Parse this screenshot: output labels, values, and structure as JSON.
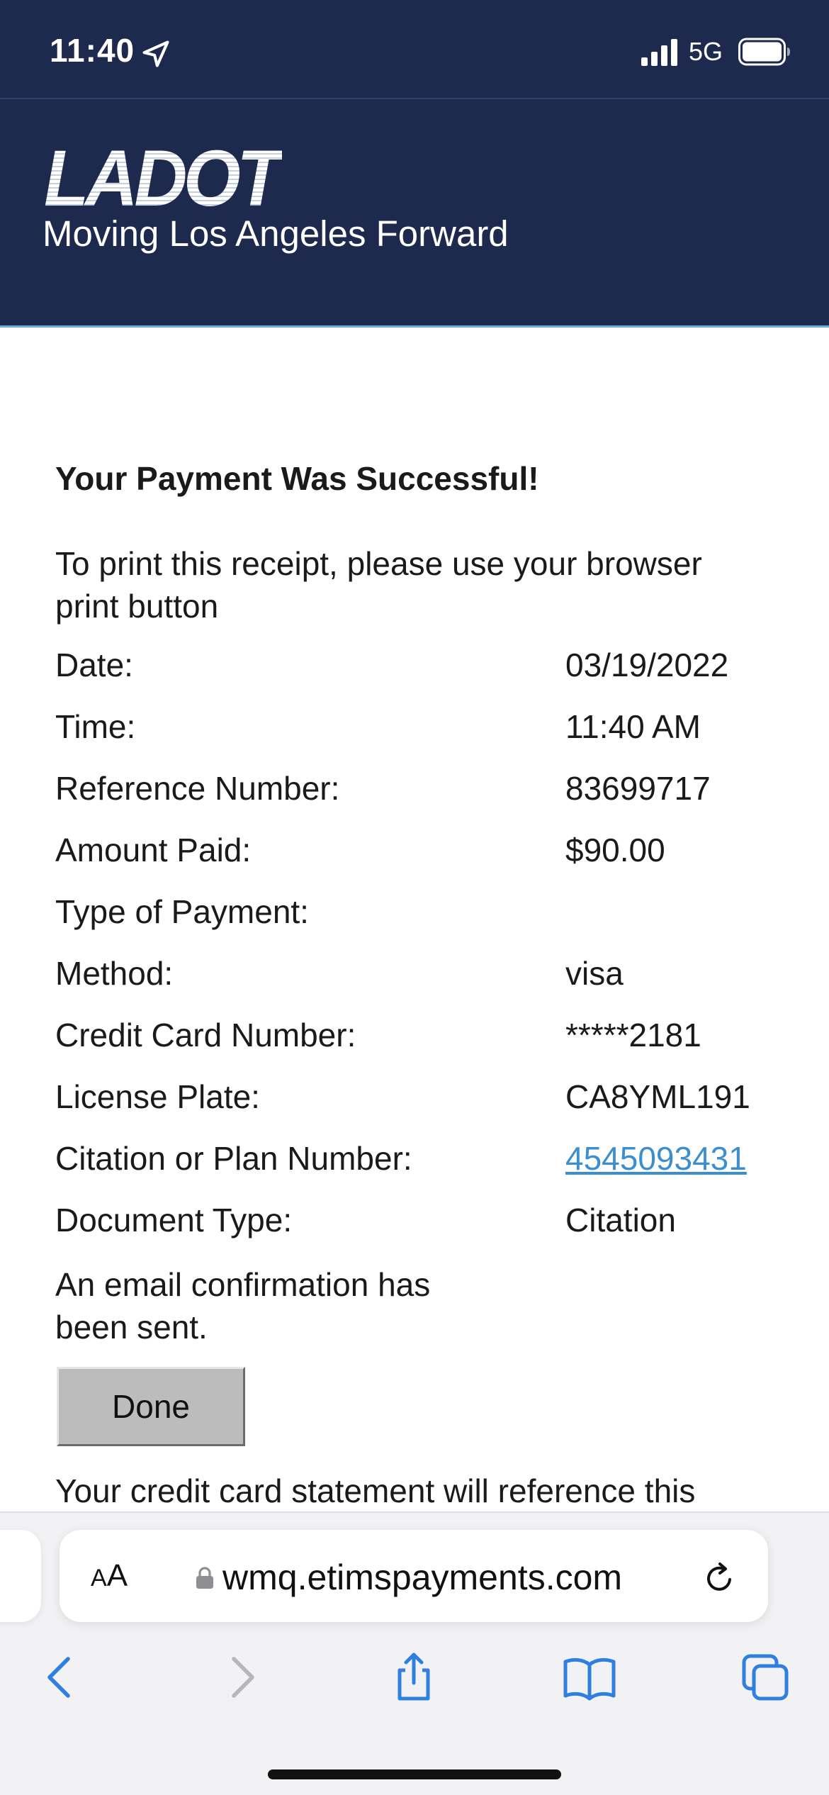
{
  "status_bar": {
    "time": "11:40",
    "network": "5G"
  },
  "header": {
    "logo_text": "LADOT",
    "tagline": "Moving Los Angeles Forward"
  },
  "receipt": {
    "headline": "Your Payment Was Successful!",
    "instruction": "To print this receipt, please use your browser print button",
    "rows": [
      {
        "label": "Date:",
        "value": "03/19/2022"
      },
      {
        "label": "Time:",
        "value": "11:40 AM"
      },
      {
        "label": "Reference Number:",
        "value": "83699717"
      },
      {
        "label": "Amount Paid:",
        "value": "$90.00"
      },
      {
        "label": "Type of Payment:",
        "value": ""
      },
      {
        "label": "Method:",
        "value": "visa"
      },
      {
        "label": "Credit Card Number:",
        "value": "*****2181"
      },
      {
        "label": "License Plate:",
        "value": "CA8YML191"
      },
      {
        "label": "Citation or Plan Number:",
        "value": "4545093431"
      },
      {
        "label": "Document Type:",
        "value": "Citation"
      }
    ],
    "email_note": "An email confirmation has been sent.",
    "done_label": "Done",
    "statement_note": "Your credit card statement will reference this"
  },
  "browser": {
    "aa_big": "A",
    "aa_small": "A",
    "url": "wmq.etimspayments.com"
  },
  "colors": {
    "header_bg": "#1e2a4d",
    "link": "#3b8fd0",
    "toolbar_active": "#2f7fe0",
    "toolbar_disabled": "#b5b5ba"
  },
  "icons": {
    "status": [
      "location-arrow-icon",
      "cellular-signal-icon",
      "battery-icon"
    ],
    "toolbar": [
      "back-icon",
      "forward-icon",
      "share-icon",
      "bookmarks-icon",
      "tabs-icon"
    ]
  }
}
